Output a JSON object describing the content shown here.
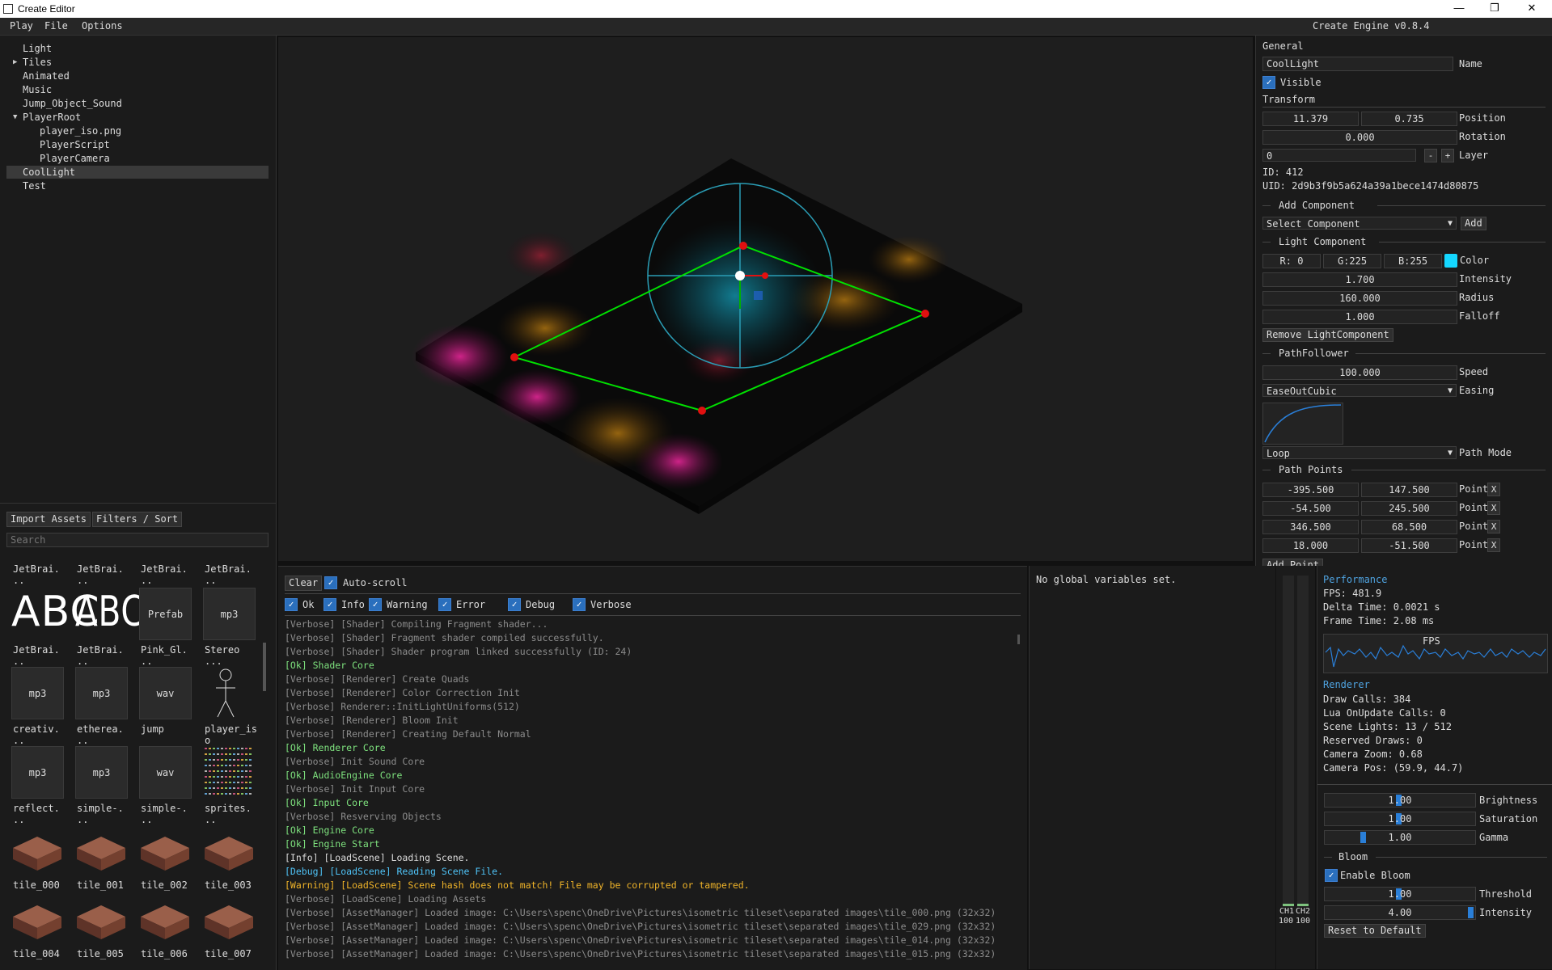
{
  "window": {
    "title": "Create Editor"
  },
  "menu": {
    "items": [
      "Play",
      "File",
      "Options"
    ],
    "version": "Create Engine v0.8.4"
  },
  "hierarchy": {
    "items": [
      {
        "label": "Light",
        "depth": 0,
        "arrow": ""
      },
      {
        "label": "Tiles",
        "depth": 0,
        "arrow": "▶"
      },
      {
        "label": "Animated",
        "depth": 0,
        "arrow": ""
      },
      {
        "label": "Music",
        "depth": 0,
        "arrow": ""
      },
      {
        "label": "Jump_Object_Sound",
        "depth": 0,
        "arrow": ""
      },
      {
        "label": "PlayerRoot",
        "depth": 0,
        "arrow": "▼"
      },
      {
        "label": "player_iso.png",
        "depth": 1,
        "arrow": ""
      },
      {
        "label": "PlayerScript",
        "depth": 1,
        "arrow": ""
      },
      {
        "label": "PlayerCamera",
        "depth": 1,
        "arrow": ""
      },
      {
        "label": "CoolLight",
        "depth": 0,
        "arrow": "",
        "selected": true
      },
      {
        "label": "Test",
        "depth": 0,
        "arrow": ""
      }
    ]
  },
  "assets": {
    "import_label": "Import Assets",
    "filters_label": "Filters / Sort",
    "search_placeholder": "Search",
    "top_labels": [
      "JetBrai.\n..",
      "JetBrai.\n..",
      "JetBrai.\n..",
      "JetBrai.\n.."
    ],
    "row1": [
      {
        "kind": "abc",
        "thumb": "ABC",
        "label": "JetBrai.\n.."
      },
      {
        "kind": "abc-narrow",
        "thumb": "ABC",
        "label": "JetBrai.\n.."
      },
      {
        "kind": "box",
        "thumb": "Prefab",
        "label": "Pink_Gl.\n.."
      },
      {
        "kind": "box",
        "thumb": "mp3",
        "label": "Stereo\n..."
      }
    ],
    "row2": [
      {
        "kind": "box",
        "thumb": "mp3",
        "label": "creativ.\n.."
      },
      {
        "kind": "box",
        "thumb": "mp3",
        "label": "etherea.\n.."
      },
      {
        "kind": "box",
        "thumb": "wav",
        "label": "jump"
      },
      {
        "kind": "figure",
        "thumb": "",
        "label": "player_is\no"
      }
    ],
    "row3": [
      {
        "kind": "box",
        "thumb": "mp3",
        "label": "reflect.\n.."
      },
      {
        "kind": "box",
        "thumb": "mp3",
        "label": "simple-.\n.."
      },
      {
        "kind": "box",
        "thumb": "wav",
        "label": "simple-.\n.."
      },
      {
        "kind": "sheet",
        "thumb": "",
        "label": "sprites.\n.."
      }
    ],
    "row4": [
      {
        "kind": "tile",
        "label": "tile_000"
      },
      {
        "kind": "tile",
        "label": "tile_001"
      },
      {
        "kind": "tile",
        "label": "tile_002"
      },
      {
        "kind": "tile",
        "label": "tile_003"
      }
    ],
    "row5": [
      {
        "kind": "tile",
        "label": "tile_004"
      },
      {
        "kind": "tile",
        "label": "tile_005"
      },
      {
        "kind": "tile",
        "label": "tile_006"
      },
      {
        "kind": "tile",
        "label": "tile_007"
      }
    ]
  },
  "inspector": {
    "general": "General",
    "name_value": "CoolLight",
    "name_label": "Name",
    "visible_label": "Visible",
    "transform": "Transform",
    "pos_x": "11.379",
    "pos_y": "0.735",
    "position_label": "Position",
    "rotation": "0.000",
    "rotation_label": "Rotation",
    "layer": "0",
    "layer_minus": "-",
    "layer_plus": "+",
    "layer_label": "Layer",
    "id": "ID: 412",
    "uid": "UID: 2d9b3f9b5a624a39a1bece1474d80875",
    "add_component": "Add Component",
    "select_component": "Select Component",
    "add_btn": "Add",
    "light_component": "Light Component",
    "r": "R:  0",
    "g": "G:225",
    "b": "B:255",
    "color_label": "Color",
    "light_color": "#14d7ff",
    "intensity": "1.700",
    "intensity_label": "Intensity",
    "radius": "160.000",
    "radius_label": "Radius",
    "falloff": "1.000",
    "falloff_label": "Falloff",
    "remove_light": "Remove LightComponent",
    "path_follower": "PathFollower",
    "speed": "100.000",
    "speed_label": "Speed",
    "easing": "EaseOutCubic",
    "easing_label": "Easing",
    "path_mode": "Loop",
    "path_mode_label": "Path Mode",
    "path_points": "Path Points",
    "point_label": "Point",
    "points": [
      {
        "x": "-395.500",
        "y": "147.500"
      },
      {
        "x": "-54.500",
        "y": "245.500"
      },
      {
        "x": "346.500",
        "y": "68.500"
      },
      {
        "x": "18.000",
        "y": "-51.500"
      }
    ],
    "remove_x": "X",
    "add_point": "Add Point"
  },
  "console": {
    "clear": "Clear",
    "autoscroll": "Auto-scroll",
    "filters": [
      "Ok",
      "Info",
      "Warning",
      "Error",
      "Debug",
      "Verbose"
    ],
    "lines": [
      {
        "text": "[Verbose] [Shader] Compiling Fragment shader...",
        "level": "verbose"
      },
      {
        "text": "[Verbose] [Shader] Fragment shader compiled successfully.",
        "level": "verbose"
      },
      {
        "text": "[Verbose] [Shader] Shader program linked successfully (ID: 24)",
        "level": "verbose"
      },
      {
        "text": "[Ok] Shader Core",
        "level": "ok"
      },
      {
        "text": "[Verbose] [Renderer] Create Quads",
        "level": "verbose"
      },
      {
        "text": "[Verbose] [Renderer] Color Correction Init",
        "level": "verbose"
      },
      {
        "text": "[Verbose] Renderer::InitLightUniforms(512)",
        "level": "verbose"
      },
      {
        "text": "[Verbose] [Renderer] Bloom Init",
        "level": "verbose"
      },
      {
        "text": "[Verbose] [Renderer] Creating Default Normal",
        "level": "verbose"
      },
      {
        "text": "[Ok] Renderer Core",
        "level": "ok"
      },
      {
        "text": "[Verbose] Init Sound Core",
        "level": "verbose"
      },
      {
        "text": "[Ok] AudioEngine Core",
        "level": "ok"
      },
      {
        "text": "[Verbose] Init Input Core",
        "level": "verbose"
      },
      {
        "text": "[Ok] Input Core",
        "level": "ok"
      },
      {
        "text": "[Verbose] Resverving Objects",
        "level": "verbose"
      },
      {
        "text": "[Ok] Engine Core",
        "level": "ok"
      },
      {
        "text": "[Ok] Engine Start",
        "level": "ok"
      },
      {
        "text": "[Info] [LoadScene] Loading Scene.",
        "level": "info"
      },
      {
        "text": "[Debug] [LoadScene] Reading Scene File.",
        "level": "debug"
      },
      {
        "text": "[Warning] [LoadScene] Scene hash does not match! File may be corrupted or tampered.",
        "level": "warning"
      },
      {
        "text": "[Verbose] [LoadScene] Loading Assets",
        "level": "verbose"
      },
      {
        "text": "[Verbose] [AssetManager] Loaded image: C:\\Users\\spenc\\OneDrive\\Pictures\\isometric tileset\\separated images\\tile_000.png (32x32)",
        "level": "verbose"
      },
      {
        "text": "[Verbose] [AssetManager] Loaded image: C:\\Users\\spenc\\OneDrive\\Pictures\\isometric tileset\\separated images\\tile_029.png (32x32)",
        "level": "verbose"
      },
      {
        "text": "[Verbose] [AssetManager] Loaded image: C:\\Users\\spenc\\OneDrive\\Pictures\\isometric tileset\\separated images\\tile_014.png (32x32)",
        "level": "verbose"
      },
      {
        "text": "[Verbose] [AssetManager] Loaded image: C:\\Users\\spenc\\OneDrive\\Pictures\\isometric tileset\\separated images\\tile_015.png (32x32)",
        "level": "verbose"
      }
    ],
    "colors": {
      "verbose": "#8c8c8c",
      "ok": "#7ee27e",
      "info": "#dcdcdc",
      "debug": "#4fc3f7",
      "warning": "#f0b429"
    }
  },
  "globals": {
    "empty_text": "No global variables set."
  },
  "meters": {
    "ch1": "CH1",
    "ch2": "CH2",
    "v1": "100",
    "v2": "100"
  },
  "performance": {
    "title": "Performance",
    "fps": "FPS:         481.9",
    "delta": "Delta Time: 0.0021 s",
    "frame": "Frame Time: 2.08 ms",
    "graph_label": "FPS",
    "renderer_title": "Renderer",
    "draw_calls": "Draw Calls:      384",
    "lua_calls": "Lua OnUpdate Calls:   0",
    "scene_lights": "Scene Lights:   13 / 512",
    "reserved": "Reserved Draws: 0",
    "zoom": "Camera Zoom:    0.68",
    "cam_pos": "Camera Pos:     (59.9, 44.7)",
    "brightness": "1.00",
    "brightness_label": "Brightness",
    "saturation": "1.00",
    "saturation_label": "Saturation",
    "gamma": "1.00",
    "gamma_label": "Gamma",
    "bloom": "Bloom",
    "enable_bloom": "Enable Bloom",
    "threshold": "1.00",
    "threshold_label": "Threshold",
    "bloom_intensity": "4.00",
    "bloom_intensity_label": "Intensity",
    "reset": "Reset to Default"
  },
  "colors": {
    "accent": "#2a6fbd",
    "path": "#00e000",
    "node": "#e01010",
    "light_ring": "#2a9db5"
  }
}
